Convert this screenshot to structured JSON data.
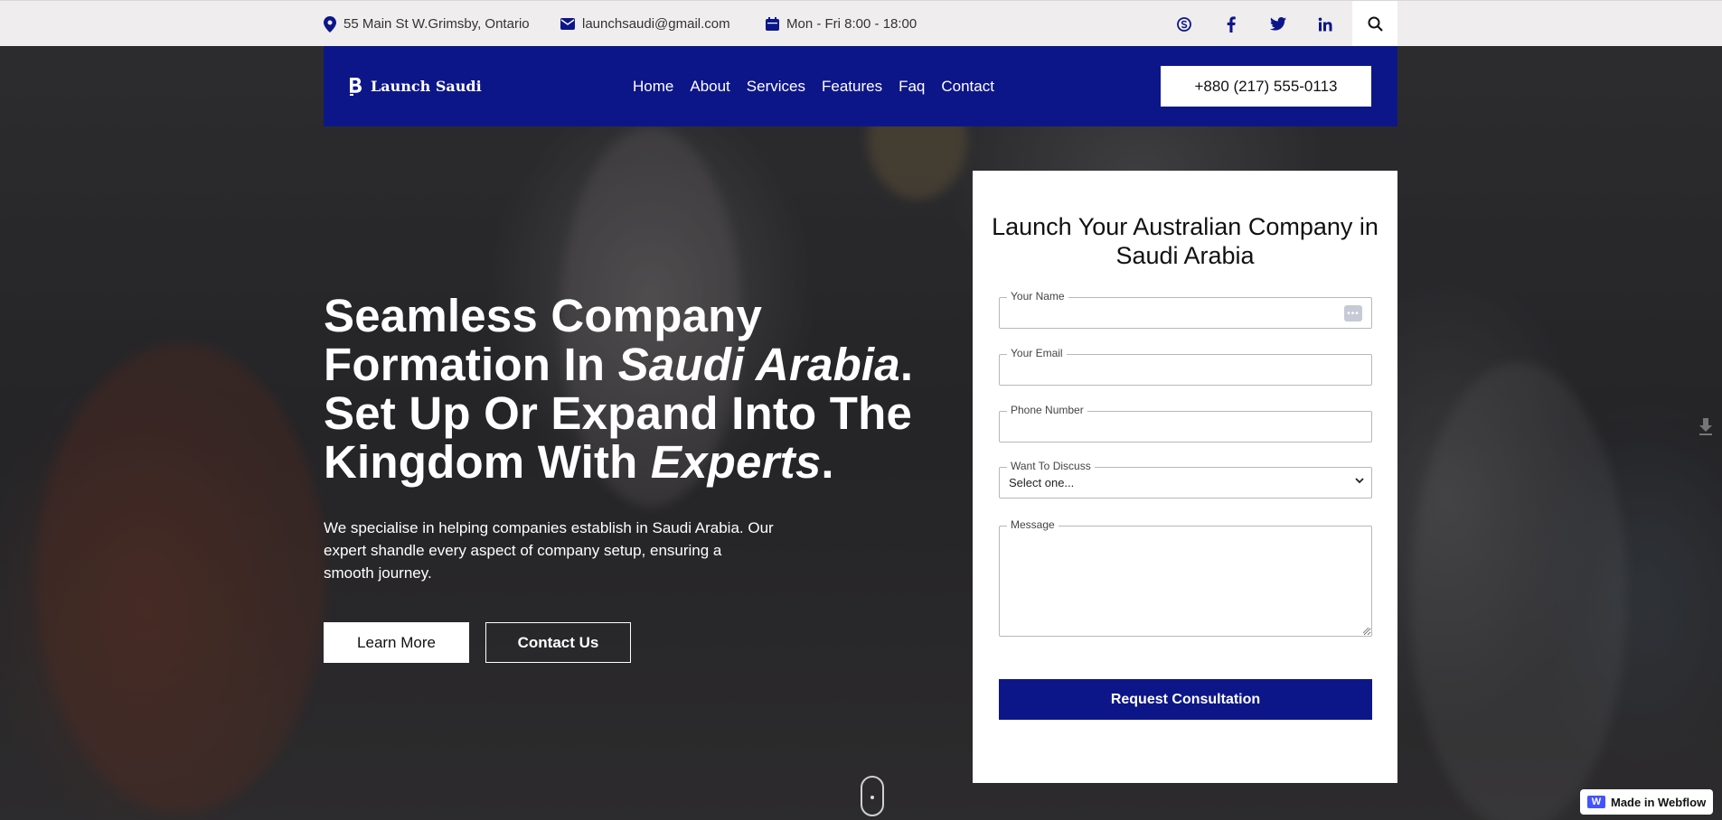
{
  "topbar": {
    "address": "55 Main St W.Grimsby, Ontario",
    "email": "launchsaudi@gmail.com",
    "hours": "Mon - Fri 8:00 - 18:00",
    "social": [
      {
        "icon": "skype-icon",
        "glyph": "ⓢ"
      },
      {
        "icon": "facebook-icon",
        "glyph": "f"
      },
      {
        "icon": "twitter-icon",
        "glyph": ""
      },
      {
        "icon": "linkedin-icon",
        "glyph": "in"
      }
    ],
    "search_icon": "search-icon"
  },
  "nav": {
    "brand": "Launch Saudi",
    "menu": [
      "Home",
      "About",
      "Services",
      "Features",
      "Faq",
      "Contact"
    ],
    "phone": "+880 (217) 555-0113"
  },
  "hero": {
    "headline_1": "Seamless Company",
    "headline_2a": "Formation In ",
    "headline_2b": "Saudi Arabia",
    "headline_2c": ".",
    "headline_3": "Set Up Or Expand Into The",
    "headline_4a": "Kingdom With ",
    "headline_4b": "Experts",
    "headline_4c": ".",
    "subtext": "We specialise in helping companies establish in Saudi Arabia. Our expert shandle every aspect of company setup, ensuring a smooth journey.",
    "learn_more": "Learn More",
    "contact_us": "Contact Us"
  },
  "form": {
    "title": "Launch Your Australian Company in Saudi Arabia",
    "name_label": "Your Name",
    "email_label": "Your Email",
    "phone_label": "Phone Number",
    "discuss_label": "Want To Discuss",
    "discuss_value": "Select one...",
    "message_label": "Message",
    "submit": "Request Consultation"
  },
  "badge": {
    "text": "Made in Webflow"
  },
  "colors": {
    "brand": "#0d1688",
    "topbar_bg": "#efedee"
  }
}
